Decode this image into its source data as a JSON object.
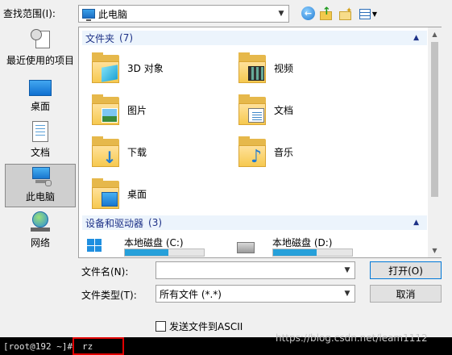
{
  "lookin": {
    "label": "查找范围(I):",
    "value": "此电脑"
  },
  "places": [
    {
      "label": "最近使用的项目",
      "icon": "recent-items-icon"
    },
    {
      "label": "桌面",
      "icon": "desktop-icon"
    },
    {
      "label": "文档",
      "icon": "documents-icon"
    },
    {
      "label": "此电脑",
      "icon": "this-pc-icon",
      "selected": true
    },
    {
      "label": "网络",
      "icon": "network-icon"
    }
  ],
  "groups": {
    "folders": {
      "name": "文件夹",
      "count": "(7)"
    },
    "drives": {
      "name": "设备和驱动器",
      "count": "(3)"
    }
  },
  "folders": [
    {
      "label": "3D 对象",
      "icon": "3d-objects-folder-icon"
    },
    {
      "label": "视频",
      "icon": "videos-folder-icon"
    },
    {
      "label": "图片",
      "icon": "pictures-folder-icon"
    },
    {
      "label": "文档",
      "icon": "documents-folder-icon"
    },
    {
      "label": "下载",
      "icon": "downloads-folder-icon"
    },
    {
      "label": "音乐",
      "icon": "music-folder-icon"
    },
    {
      "label": "桌面",
      "icon": "desktop-folder-icon"
    }
  ],
  "drives": [
    {
      "label": "本地磁盘 (C:)",
      "used_fraction": 0.55
    },
    {
      "label": "本地磁盘 (D:)",
      "used_fraction": 0.55
    }
  ],
  "filename": {
    "label": "文件名(N):",
    "value": ""
  },
  "filetype": {
    "label": "文件类型(T):",
    "value": "所有文件 (*.*)"
  },
  "buttons": {
    "open": "打开(O)",
    "cancel": "取消"
  },
  "ascii_checkbox": {
    "label": "发送文件到ASCII",
    "checked": false
  },
  "terminal": {
    "prompt": "[root@192 ~]#",
    "command": "rz"
  },
  "watermark": "https://blog.csdn.net/leam1112"
}
